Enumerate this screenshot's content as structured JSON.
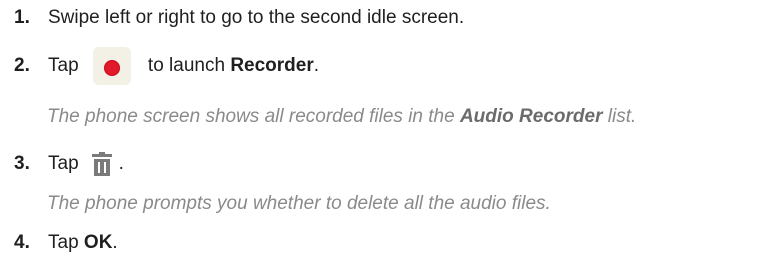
{
  "steps": [
    {
      "number": "1.",
      "text": "Swipe left or right to go to the second idle screen."
    },
    {
      "number": "2.",
      "pre": "Tap",
      "icon": "recorder-icon",
      "post": " to launch ",
      "bold": "Recorder",
      "end": "."
    },
    {
      "number": "3.",
      "pre": "Tap",
      "icon": "trash-icon",
      "end": "."
    },
    {
      "number": "4.",
      "pre": "Tap ",
      "bold": "OK",
      "end": "."
    }
  ],
  "notes": [
    {
      "pre": "The phone screen shows all recorded files in the ",
      "bold": "Audio Recorder",
      "post": " list."
    },
    {
      "text": "The phone prompts you whether to delete all the audio files."
    }
  ],
  "colors": {
    "recorder_dot": "#e01a2a",
    "trash": "#7a7a7a",
    "note_text": "#8a8a8a"
  }
}
